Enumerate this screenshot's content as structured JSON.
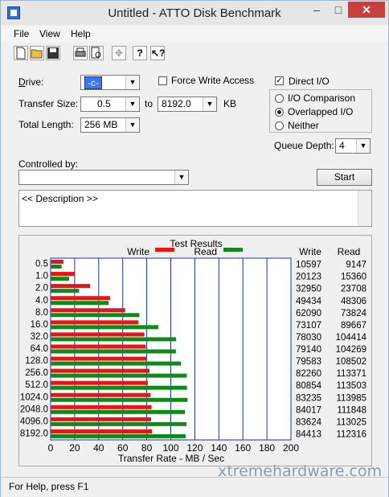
{
  "window": {
    "title": "Untitled - ATTO Disk Benchmark",
    "minimize": "–",
    "maximize": "□",
    "close": "✕"
  },
  "menu": [
    "File",
    "View",
    "Help"
  ],
  "toolbar": {
    "new": "new-icon",
    "open": "open-icon",
    "save": "save-icon",
    "print": "print-icon",
    "preview": "print-preview-icon",
    "move": "move-icon",
    "help": "help-icon",
    "context_help": "context-help-icon"
  },
  "form": {
    "drive_label": "Drive:",
    "drive_value": "-c-",
    "force_write_label": "Force Write Access",
    "force_write_checked": false,
    "direct_io_label": "Direct I/O",
    "direct_io_checked": true,
    "transfer_size_label": "Transfer Size:",
    "transfer_from": "0.5",
    "to_label": "to",
    "transfer_to": "8192.0",
    "kb_label": "KB",
    "total_length_label": "Total Length:",
    "total_length_value": "256 MB",
    "io_options": [
      "I/O Comparison",
      "Overlapped I/O",
      "Neither"
    ],
    "io_selected": "Overlapped I/O",
    "queue_depth_label": "Queue Depth:",
    "queue_depth_value": "4",
    "controlled_by_label": "Controlled by:",
    "controlled_by_value": "",
    "start_label": "Start",
    "description": "<< Description >>"
  },
  "results": {
    "title": "Test Results",
    "write_legend": "Write",
    "read_legend": "Read",
    "col_write": "Write",
    "col_read": "Read",
    "colors": {
      "write": "#e81416",
      "read": "#0f8a17",
      "grid": "#1e2fa8"
    }
  },
  "chart_data": {
    "type": "bar",
    "title": "Test Results",
    "xlabel": "Transfer Rate - MB / Sec",
    "xlim": [
      0,
      200
    ],
    "xticks": [
      0,
      20,
      40,
      60,
      80,
      100,
      120,
      140,
      160,
      180,
      200
    ],
    "categories": [
      "0.5",
      "1.0",
      "2.0",
      "4.0",
      "8.0",
      "16.0",
      "32.0",
      "64.0",
      "128.0",
      "256.0",
      "512.0",
      "1024.0",
      "2048.0",
      "4096.0",
      "8192.0"
    ],
    "series": [
      {
        "name": "Write",
        "values": [
          10597,
          20123,
          32950,
          49434,
          62090,
          73107,
          78030,
          79140,
          79583,
          82260,
          80854,
          83235,
          84017,
          83624,
          84413
        ]
      },
      {
        "name": "Read",
        "values": [
          9147,
          15360,
          23708,
          48306,
          73824,
          89667,
          104414,
          104269,
          108502,
          113371,
          113503,
          113985,
          111848,
          113025,
          112316
        ]
      }
    ]
  },
  "status": {
    "text": "For Help, press F1"
  },
  "watermark": "xtremehardware.com"
}
